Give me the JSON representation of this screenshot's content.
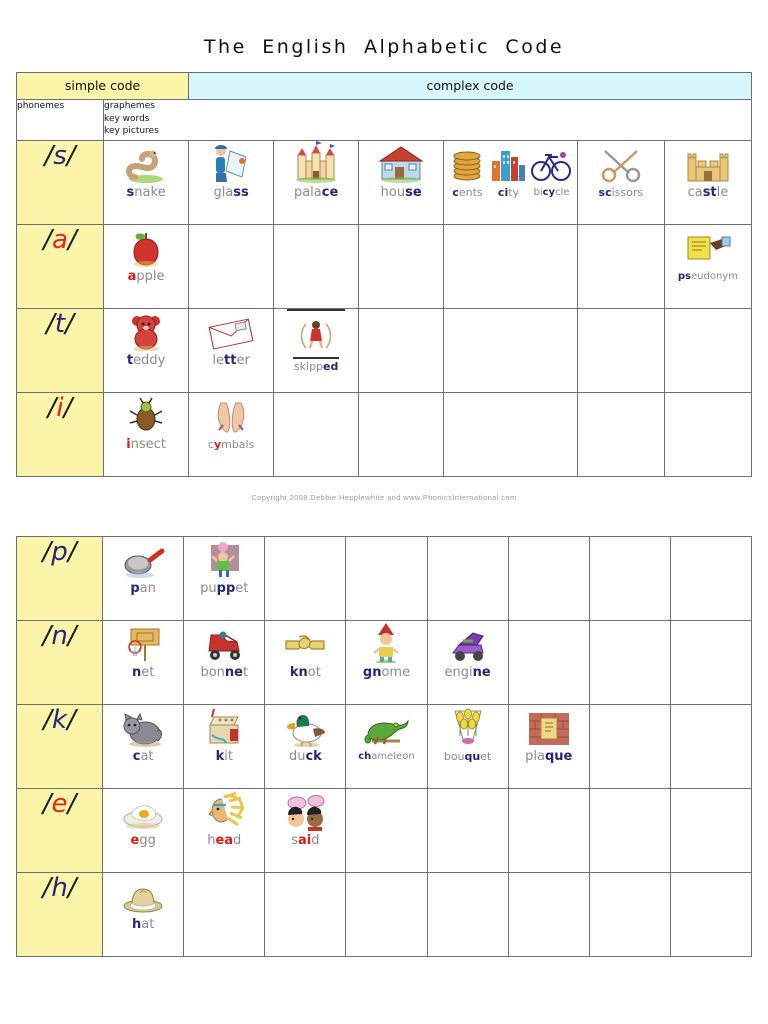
{
  "document": {
    "title": "The  English  Alphabetic  Code",
    "copyright": "Copyright 2008 Debbie Hepplewhite and www.PhonicsInternational.com"
  },
  "colors": {
    "simple_code_bg": "#faf5a8",
    "complex_code_bg": "#d6f7fb",
    "grapheme_blue": "#26267a",
    "grapheme_red": "#d81e12",
    "word_grey": "#8a8a8a",
    "border": "#6f6f6f"
  },
  "header": {
    "simple_code": "simple code",
    "complex_code": "complex code",
    "phonemes_label": "phonemes",
    "graphemes_label": "graphemes",
    "key_words_label": "key words",
    "key_pictures_label": "key pictures"
  },
  "table1": {
    "rows": [
      {
        "phoneme": "/s/",
        "phoneme_letter": "s",
        "phoneme_color": "blue",
        "cells": [
          {
            "words": [
              {
                "text": "snake",
                "grapheme": "s",
                "grapheme_index": 0,
                "picture": "snake"
              }
            ]
          },
          {
            "words": [
              {
                "text": "glass",
                "grapheme": "ss",
                "grapheme_index": 3,
                "picture": "glass"
              }
            ]
          },
          {
            "words": [
              {
                "text": "palace",
                "grapheme": "ce",
                "grapheme_index": 4,
                "picture": "palace"
              }
            ]
          },
          {
            "words": [
              {
                "text": "house",
                "grapheme": "se",
                "grapheme_index": 3,
                "picture": "house"
              }
            ]
          },
          {
            "words": [
              {
                "text": "cents",
                "grapheme": "c",
                "grapheme_index": 0,
                "picture": "cents"
              },
              {
                "text": "city",
                "grapheme": "ci",
                "grapheme_index": 0,
                "picture": "city"
              },
              {
                "text": "bicycle",
                "grapheme": "cy",
                "grapheme_index": 2,
                "picture": "bicycle"
              }
            ]
          },
          {
            "words": [
              {
                "text": "scissors",
                "grapheme": "sc",
                "grapheme_index": 0,
                "picture": "scissors"
              }
            ]
          },
          {
            "words": [
              {
                "text": "castle",
                "grapheme": "st",
                "grapheme_index": 2,
                "picture": "castle"
              }
            ]
          }
        ]
      },
      {
        "phoneme": "/a/",
        "phoneme_letter": "a",
        "phoneme_color": "red",
        "cells": [
          {
            "words": [
              {
                "text": "apple",
                "grapheme": "a",
                "grapheme_index": 0,
                "picture": "apple",
                "color": "red"
              }
            ]
          },
          {
            "words": []
          },
          {
            "words": []
          },
          {
            "words": []
          },
          {
            "words": []
          },
          {
            "words": []
          },
          {
            "words": [
              {
                "text": "pseudonym",
                "grapheme": "ps",
                "grapheme_index": 0,
                "picture": "pseudonym"
              }
            ]
          }
        ]
      },
      {
        "phoneme": "/t/",
        "phoneme_letter": "t",
        "phoneme_color": "blue",
        "cells": [
          {
            "words": [
              {
                "text": "teddy",
                "grapheme": "t",
                "grapheme_index": 0,
                "picture": "teddy"
              }
            ]
          },
          {
            "words": [
              {
                "text": "letter",
                "grapheme": "tt",
                "grapheme_index": 2,
                "picture": "letter"
              }
            ]
          },
          {
            "words": [
              {
                "text": "skipped",
                "grapheme": "ed",
                "grapheme_index": 5,
                "picture": "skipped"
              }
            ]
          },
          {
            "words": []
          },
          {
            "words": []
          },
          {
            "words": []
          },
          {
            "words": []
          }
        ]
      },
      {
        "phoneme": "/i/",
        "phoneme_letter": "i",
        "phoneme_color": "red",
        "cells": [
          {
            "words": [
              {
                "text": "insect",
                "grapheme": "i",
                "grapheme_index": 0,
                "picture": "insect",
                "color": "red"
              }
            ]
          },
          {
            "words": [
              {
                "text": "cymbals",
                "grapheme": "y",
                "grapheme_index": 1,
                "picture": "cymbals",
                "color": "red"
              }
            ]
          },
          {
            "words": []
          },
          {
            "words": []
          },
          {
            "words": []
          },
          {
            "words": []
          },
          {
            "words": []
          }
        ]
      }
    ]
  },
  "table2": {
    "rows": [
      {
        "phoneme": "/p/",
        "phoneme_letter": "p",
        "phoneme_color": "blue",
        "cells": [
          {
            "words": [
              {
                "text": "pan",
                "grapheme": "p",
                "grapheme_index": 0,
                "picture": "pan"
              }
            ]
          },
          {
            "words": [
              {
                "text": "puppet",
                "grapheme": "pp",
                "grapheme_index": 2,
                "picture": "puppet"
              }
            ]
          },
          {
            "words": []
          },
          {
            "words": []
          },
          {
            "words": []
          },
          {
            "words": []
          },
          {
            "words": []
          },
          {
            "words": []
          }
        ]
      },
      {
        "phoneme": "/n/",
        "phoneme_letter": "n",
        "phoneme_color": "blue",
        "cells": [
          {
            "words": [
              {
                "text": "net",
                "grapheme": "n",
                "grapheme_index": 0,
                "picture": "net"
              }
            ]
          },
          {
            "words": [
              {
                "text": "bonnet",
                "grapheme": "nn",
                "grapheme_index": 3,
                "picture": "bonnet"
              }
            ]
          },
          {
            "words": [
              {
                "text": "knot",
                "grapheme": "kn",
                "grapheme_index": 0,
                "picture": "knot"
              }
            ]
          },
          {
            "words": [
              {
                "text": "gnome",
                "grapheme": "gn",
                "grapheme_index": 0,
                "picture": "gnome"
              }
            ]
          },
          {
            "words": [
              {
                "text": "engine",
                "grapheme": "ne",
                "grapheme_index": 4,
                "picture": "engine"
              }
            ]
          },
          {
            "words": []
          },
          {
            "words": []
          },
          {
            "words": []
          }
        ]
      },
      {
        "phoneme": "/k/",
        "phoneme_letter": "k",
        "phoneme_color": "blue",
        "cells": [
          {
            "words": [
              {
                "text": "cat",
                "grapheme": "c",
                "grapheme_index": 0,
                "picture": "cat"
              }
            ]
          },
          {
            "words": [
              {
                "text": "kit",
                "grapheme": "k",
                "grapheme_index": 0,
                "picture": "kit"
              }
            ]
          },
          {
            "words": [
              {
                "text": "duck",
                "grapheme": "ck",
                "grapheme_index": 2,
                "picture": "duck"
              }
            ]
          },
          {
            "words": [
              {
                "text": "chameleon",
                "grapheme": "ch",
                "grapheme_index": 0,
                "picture": "chameleon"
              }
            ]
          },
          {
            "words": [
              {
                "text": "bouquet",
                "grapheme": "qu",
                "grapheme_index": 3,
                "picture": "bouquet"
              }
            ]
          },
          {
            "words": [
              {
                "text": "plaque",
                "grapheme": "que",
                "grapheme_index": 3,
                "picture": "plaque"
              }
            ]
          },
          {
            "words": []
          },
          {
            "words": []
          }
        ]
      },
      {
        "phoneme": "/e/",
        "phoneme_letter": "e",
        "phoneme_color": "red",
        "cells": [
          {
            "words": [
              {
                "text": "egg",
                "grapheme": "e",
                "grapheme_index": 0,
                "picture": "egg",
                "color": "red"
              }
            ]
          },
          {
            "words": [
              {
                "text": "head",
                "grapheme": "ea",
                "grapheme_index": 1,
                "picture": "head",
                "color": "red"
              }
            ]
          },
          {
            "words": [
              {
                "text": "said",
                "grapheme": "ai",
                "grapheme_index": 1,
                "picture": "said",
                "color": "red"
              }
            ]
          },
          {
            "words": []
          },
          {
            "words": []
          },
          {
            "words": []
          },
          {
            "words": []
          },
          {
            "words": []
          }
        ]
      },
      {
        "phoneme": "/h/",
        "phoneme_letter": "h",
        "phoneme_color": "blue",
        "cells": [
          {
            "words": [
              {
                "text": "hat",
                "grapheme": "h",
                "grapheme_index": 0,
                "picture": "hat"
              }
            ]
          },
          {
            "words": []
          },
          {
            "words": []
          },
          {
            "words": []
          },
          {
            "words": []
          },
          {
            "words": []
          },
          {
            "words": []
          },
          {
            "words": []
          }
        ]
      }
    ]
  }
}
